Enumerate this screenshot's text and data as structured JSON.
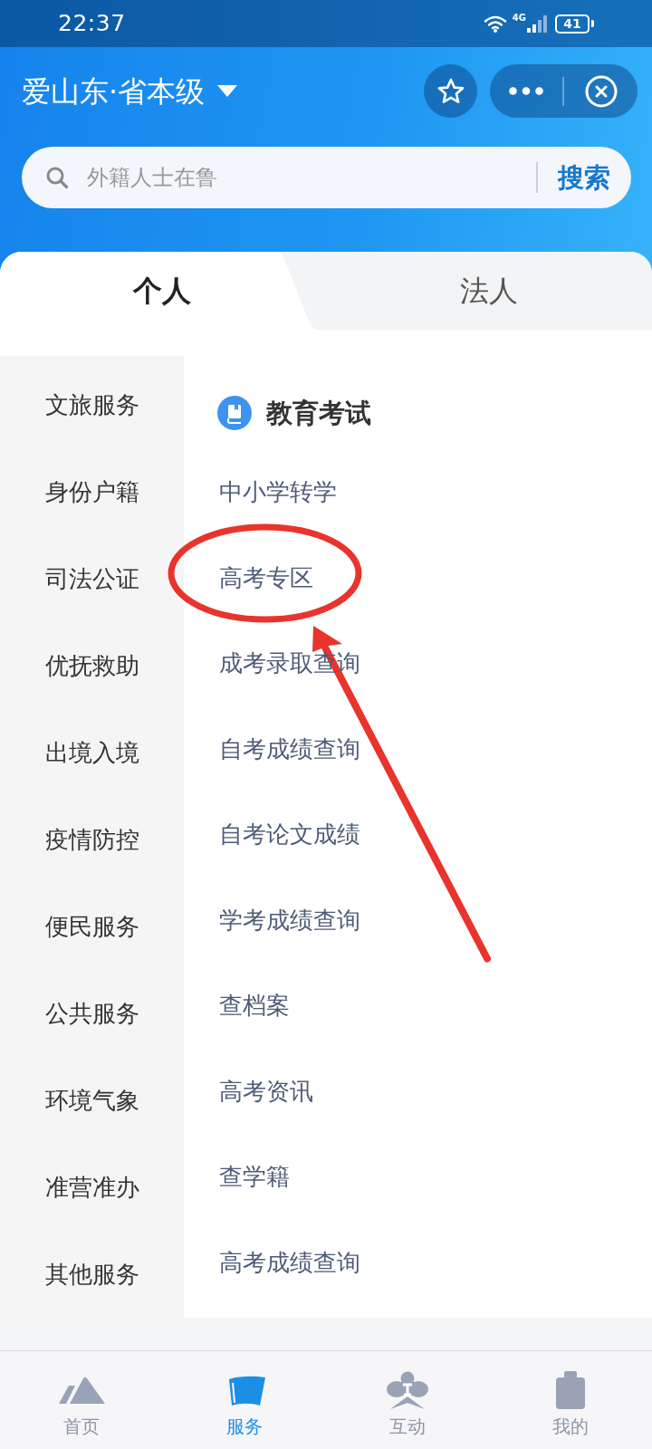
{
  "status_bar": {
    "time": "22:37",
    "network": "4G",
    "battery": "41"
  },
  "header": {
    "title": "爱山东·省本级"
  },
  "search": {
    "placeholder": "外籍人士在鲁",
    "button": "搜索"
  },
  "tabs": [
    {
      "label": "个人",
      "selected": true
    },
    {
      "label": "法人",
      "selected": false
    }
  ],
  "sidebar": {
    "items": [
      {
        "label": "文旅服务",
        "selected": false
      },
      {
        "label": "身份户籍",
        "selected": false
      },
      {
        "label": "司法公证",
        "selected": false
      },
      {
        "label": "优抚救助",
        "selected": false
      },
      {
        "label": "出境入境",
        "selected": false
      },
      {
        "label": "疫情防控",
        "selected": false
      },
      {
        "label": "便民服务",
        "selected": false
      },
      {
        "label": "公共服务",
        "selected": false
      },
      {
        "label": "环境气象",
        "selected": false
      },
      {
        "label": "准营准办",
        "selected": false
      },
      {
        "label": "其他服务",
        "selected": false
      }
    ]
  },
  "section": {
    "title": "教育考试",
    "links": [
      {
        "label": "中小学转学",
        "circled": false
      },
      {
        "label": "高考专区",
        "circled": true
      },
      {
        "label": "成考录取查询",
        "circled": false
      },
      {
        "label": "自考成绩查询",
        "circled": false
      },
      {
        "label": "自考论文成绩",
        "circled": false
      },
      {
        "label": "学考成绩查询",
        "circled": false
      },
      {
        "label": "查档案",
        "circled": false
      },
      {
        "label": "高考资讯",
        "circled": false
      },
      {
        "label": "查学籍",
        "circled": false
      },
      {
        "label": "高考成绩查询",
        "circled": false
      }
    ]
  },
  "bottom_nav": {
    "items": [
      {
        "label": "首页",
        "kind": "home",
        "selected": false
      },
      {
        "label": "服务",
        "kind": "service",
        "selected": true
      },
      {
        "label": "互动",
        "kind": "interact",
        "selected": false
      },
      {
        "label": "我的",
        "kind": "profile",
        "selected": false
      }
    ]
  }
}
